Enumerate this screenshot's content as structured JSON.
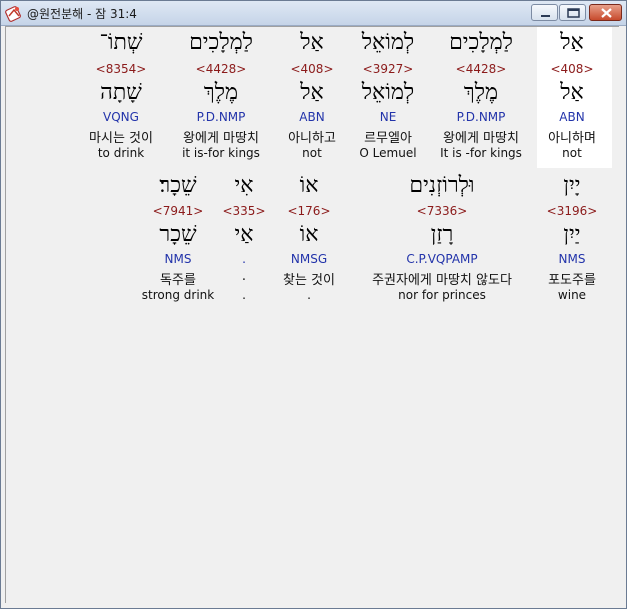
{
  "window": {
    "title": "@원전분해 - 잠 31:4"
  },
  "row1": [
    {
      "hebrew": "אַל",
      "strong": "<408>",
      "lemma": "אַל",
      "parse": "ABN",
      "korean": "아니하며",
      "english": "not"
    },
    {
      "hebrew": "לַמְלָכִים",
      "strong": "<4428>",
      "lemma": "מֶלֶךְ",
      "parse": "P.D.NMP",
      "korean": "왕에게 마땅치",
      "english": "It is -for kings"
    },
    {
      "hebrew": "לְמוֹאֵל",
      "strong": "<3927>",
      "lemma": "לְמוֹאֵל",
      "parse": "NE",
      "korean": "르무엘아",
      "english": "O Lemuel"
    },
    {
      "hebrew": "אַל",
      "strong": "<408>",
      "lemma": "אַל",
      "parse": "ABN",
      "korean": "아니하고",
      "english": "not"
    },
    {
      "hebrew": "לַמְלָכִים",
      "strong": "<4428>",
      "lemma": "מֶלֶךְ",
      "parse": "P.D.NMP",
      "korean": "왕에게 마땅치",
      "english": "it is-for kings"
    },
    {
      "hebrew": "שְׁתוֹ־",
      "strong": "<8354>",
      "lemma": "שָׁתָה",
      "parse": "VQNG",
      "korean": "마시는 것이",
      "english": "to drink"
    }
  ],
  "row2": [
    {
      "hebrew": "יָיִן",
      "strong": "<3196>",
      "lemma": "יַיִן",
      "parse": "NMS",
      "korean": "포도주를",
      "english": "wine"
    },
    {
      "hebrew": "וּלְרוֹזְנִים",
      "strong": "<7336>",
      "lemma": "רָזַן",
      "parse": "C.P.VQPAMP",
      "korean": "주권자에게 마땅치 않도다",
      "english": "nor for princes"
    },
    {
      "hebrew": "אוֹ",
      "strong": "<176>",
      "lemma": "אוֹ",
      "parse": "NMSG",
      "korean": "찾는 것이",
      "english": "."
    },
    {
      "hebrew": "אִי",
      "strong": "<335>",
      "lemma": "אַי",
      "parse": ".",
      "korean": ".",
      "english": "."
    },
    {
      "hebrew": "שֵׁכָר׃",
      "strong": "<7941>",
      "lemma": "שֵׁכָר",
      "parse": "NMS",
      "korean": "독주를",
      "english": "strong drink"
    }
  ]
}
